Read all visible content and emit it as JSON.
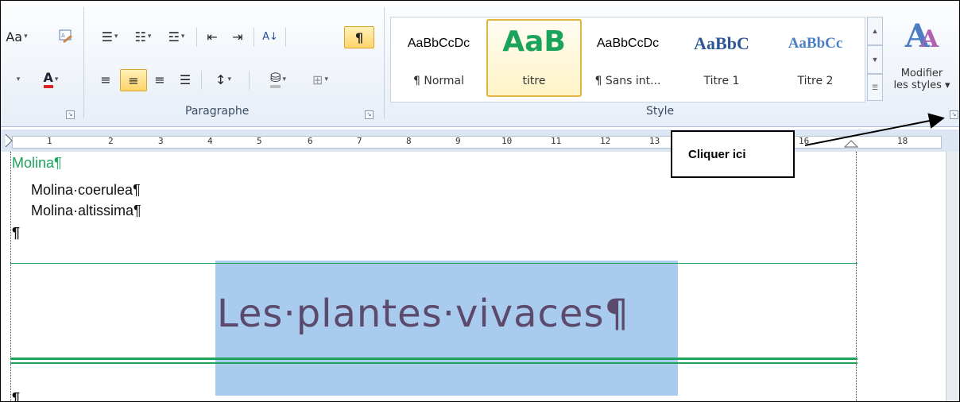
{
  "ribbon": {
    "font_group_partial": "Aa",
    "paragraph_label": "Paragraphe",
    "style_label": "Style",
    "sort_icon_text": "A↓",
    "styles": [
      {
        "sample": "AaBbCcDc",
        "name": "¶ Normal"
      },
      {
        "sample": "AaB",
        "name": "titre"
      },
      {
        "sample": "AaBbCcDc",
        "name": "¶ Sans int..."
      },
      {
        "sample": "AaBbC",
        "name": "Titre 1"
      },
      {
        "sample": "AaBbCc",
        "name": "Titre 2"
      }
    ],
    "modify_styles": {
      "line1": "Modifier",
      "line2": "les styles ▾"
    },
    "accent": "#1aa35a"
  },
  "ruler": {
    "numbers": [
      "1",
      "2",
      "3",
      "4",
      "5",
      "6",
      "7",
      "8",
      "9",
      "10",
      "11",
      "12",
      "13",
      "16",
      "18"
    ]
  },
  "document": {
    "line1": "Molina¶",
    "line2": "Molina·coerulea¶",
    "line3": "Molina·altissima¶",
    "line4": "¶",
    "title": "Les·plantes·vivaces¶",
    "line_after": "¶"
  },
  "callout": {
    "text": "Cliquer ici"
  }
}
